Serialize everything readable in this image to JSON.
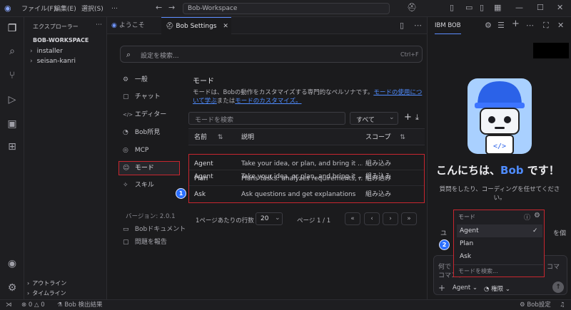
{
  "titlebar": {
    "menus": [
      "ファイル(F)",
      "編集(E)",
      "選択(S)",
      "…"
    ],
    "search": "Bob-Workspace"
  },
  "explorer": {
    "header": "エクスプローラー",
    "workspace": "BOB-WORKSPACE",
    "folders": [
      "installer",
      "seisan-kanri"
    ],
    "outline": "アウトライン",
    "timeline": "タイムライン"
  },
  "tabs": [
    {
      "label": "ようこそ"
    },
    {
      "label": "Bob Settings"
    }
  ],
  "settings": {
    "search_placeholder": "設定を検索...",
    "search_shortcut": "Ctrl+F",
    "nav": [
      {
        "icon": "⚙",
        "label": "一般"
      },
      {
        "icon": "▢",
        "label": "チャット"
      },
      {
        "icon": "</>",
        "label": "エディター"
      },
      {
        "icon": "◔",
        "label": "Bob所見"
      },
      {
        "icon": "◎",
        "label": "MCP"
      },
      {
        "icon": "☺",
        "label": "モード"
      },
      {
        "icon": "✧",
        "label": "スキル"
      }
    ],
    "version": "バージョン: 2.0.1",
    "docs": "Bobドキュメント",
    "report": "問題を報告",
    "mode_title": "モード",
    "mode_desc_1": "モードは、Bobの動作をカスタマイズする専門的なペルソナです。",
    "mode_link_1": "モードの使用につ",
    "mode_link_1b": "いて学ぶ",
    "mode_mid": "または",
    "mode_link_2": "モードのカスタマイズ。",
    "mode_search_placeholder": "モードを検索",
    "filter": "すべて",
    "columns": {
      "name": "名前",
      "desc": "説明",
      "scope": "スコープ"
    },
    "rows": [
      {
        "name": "Agent",
        "desc": "Take your idea, or plan, and bring it ...",
        "scope": "組み込み"
      },
      {
        "name": "Plan",
        "desc": "Plans tasks: analyzes requirements, r...",
        "scope": "組み込み"
      },
      {
        "name": "Ask",
        "desc": "Ask questions and get explanations",
        "scope": "組み込み"
      }
    ],
    "rows_per_page_label": "1ページあたりの行数",
    "rows_per_page": "20",
    "page_info": "ページ 1 / 1"
  },
  "badges": {
    "one": "1",
    "two": "2"
  },
  "bob": {
    "tab": "IBM BOB",
    "greeting_pre": "こんにちは、",
    "greeting_name": "Bob",
    "greeting_post": " です！",
    "subtitle": "質問をしたり、コーディングを任せてくださ",
    "subtitle_2": "い。",
    "partial_left": "ユ",
    "partial_right": "を個",
    "partial_left2": "問",
    "chat_partial_1": "何で",
    "chat_partial_1r": "コマ",
    "chat_partial_2": "コマンド",
    "dropdown": {
      "title": "モード",
      "items": [
        "Agent",
        "Plan",
        "Ask"
      ],
      "search_placeholder": "モードを検索..."
    },
    "mode_button": "Agent",
    "perm_button": "権限"
  },
  "statusbar": {
    "errors": "0",
    "warnings": "0",
    "bob_results": "Bob 検出結果",
    "bob_settings": "Bob設定"
  },
  "colors": {
    "accent": "#2b6fff",
    "highlight_border": "#c8262f",
    "link": "#4f8cff"
  }
}
